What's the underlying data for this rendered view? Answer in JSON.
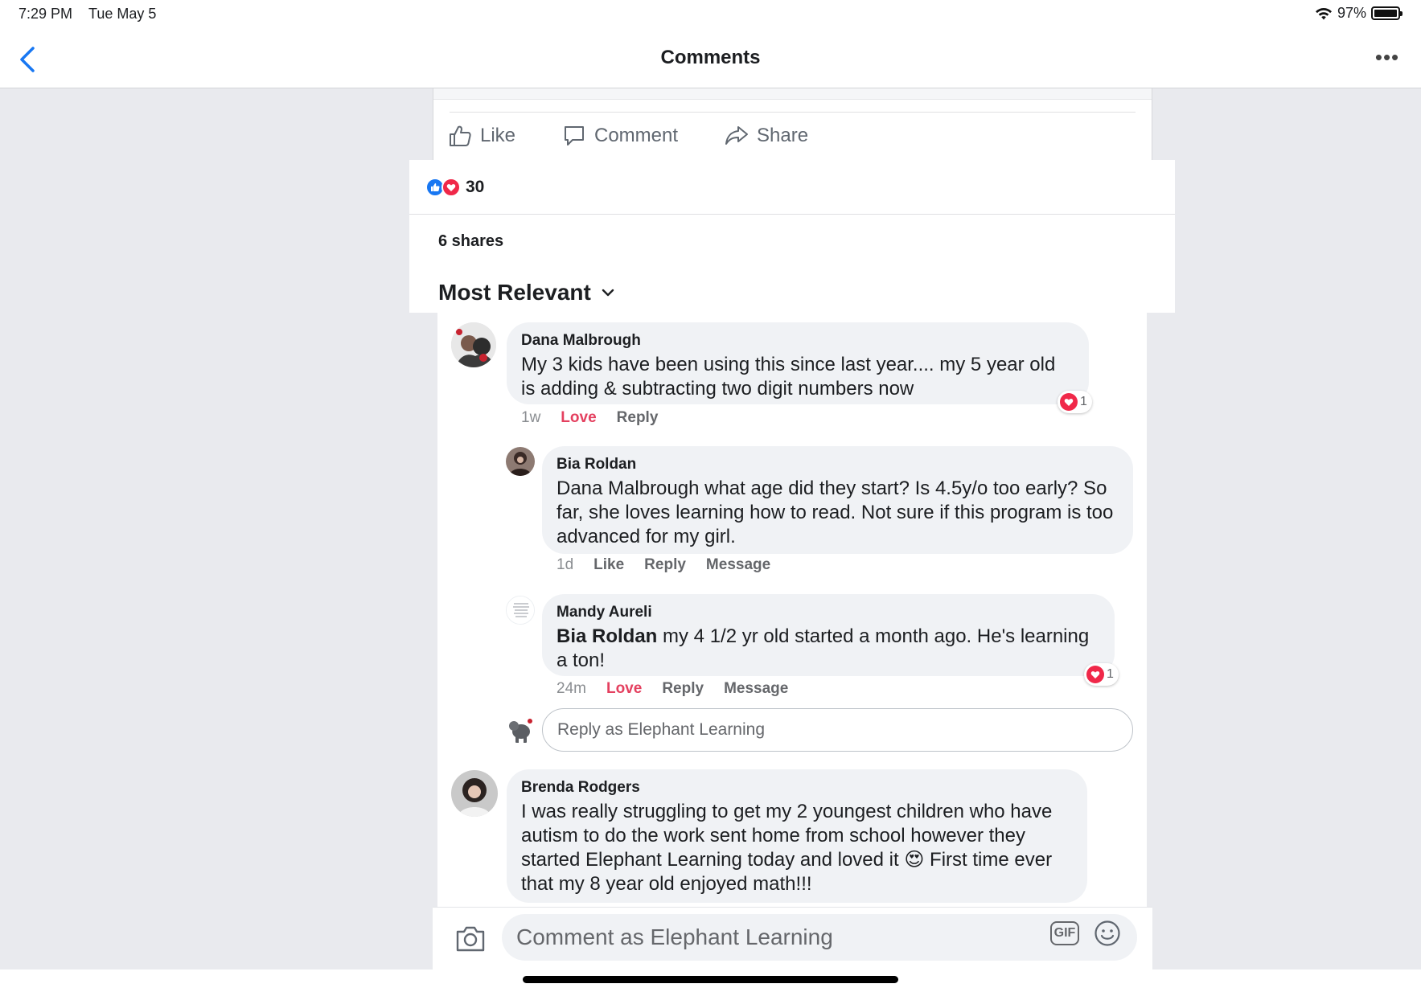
{
  "status_bar": {
    "time": "7:29 PM",
    "date": "Tue May 5",
    "battery": "97%"
  },
  "nav": {
    "title": "Comments",
    "back_icon": "chevron-left-icon",
    "more_icon": "more-horizontal-icon",
    "more_label": "•••",
    "accent_color": "#1877f2"
  },
  "post_actions": {
    "like": "Like",
    "comment": "Comment",
    "share": "Share"
  },
  "summary": {
    "reaction_count": "30",
    "shares": "6 shares",
    "sort_label": "Most Relevant"
  },
  "comments": [
    {
      "author": "Dana Malbrough",
      "text": "My 3 kids have been using this since last year.... my 5 year old is adding & subtracting two digit numbers now",
      "time": "1w",
      "reaction_label": "Love",
      "reply_label": "Reply",
      "reaction_count": "1",
      "replies": [
        {
          "author": "Bia Roldan",
          "text": "Dana Malbrough what age did they start? Is 4.5y/o too early? So far, she loves learning how to read. Not sure if this program is too advanced for my girl.",
          "time": "1d",
          "reaction_label": "Like",
          "reply_label": "Reply",
          "message_label": "Message"
        },
        {
          "author": "Mandy Aureli",
          "mention": "Bia Roldan",
          "text": "my 4 1/2 yr old started a month ago. He's learning a ton!",
          "time": "24m",
          "reaction_label": "Love",
          "reply_label": "Reply",
          "message_label": "Message",
          "reaction_count": "1"
        }
      ],
      "reply_placeholder": "Reply as Elephant Learning"
    },
    {
      "author": "Brenda Rodgers",
      "text_line1": "I was really struggling to get my 2 youngest children who have autism to do the work sent home from school however they started Elephant Learning today and loved it",
      "emoji": "😍",
      "text_line2": "First time ever that my 8 year old enjoyed math!!!"
    }
  ],
  "composer": {
    "placeholder": "Comment as Elephant Learning",
    "gif_label": "GIF"
  }
}
